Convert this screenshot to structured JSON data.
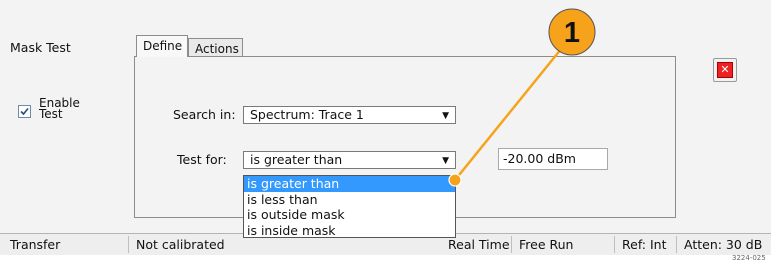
{
  "callout": {
    "number": "1"
  },
  "panel": {
    "title": "Mask Test",
    "enable_line1": "Enable",
    "enable_line2": "Test",
    "enable_checked": true
  },
  "tabs": [
    {
      "label": "Define",
      "active": true
    },
    {
      "label": "Actions",
      "active": false
    }
  ],
  "form": {
    "search_in_label": "Search in:",
    "search_in_value": "Spectrum: Trace 1",
    "test_for_label": "Test for:",
    "test_for_value": "is greater than",
    "threshold_value": "-20.00 dBm"
  },
  "dropdown": {
    "options": [
      "is greater than",
      "is less than",
      "is outside mask",
      "is inside mask"
    ],
    "selected": "is greater than"
  },
  "status_bar": {
    "transfer": "Transfer",
    "calibration": "Not calibrated",
    "mode": "Real Time",
    "run": "Free Run",
    "ref": "Ref: Int",
    "atten": "Atten: 30 dB"
  },
  "figure_code": "3224-025",
  "colors": {
    "callout_fill": "#f7a21b",
    "leader_line": "#f7a21b",
    "selection": "#3399ff",
    "close_red": "#e22222"
  }
}
